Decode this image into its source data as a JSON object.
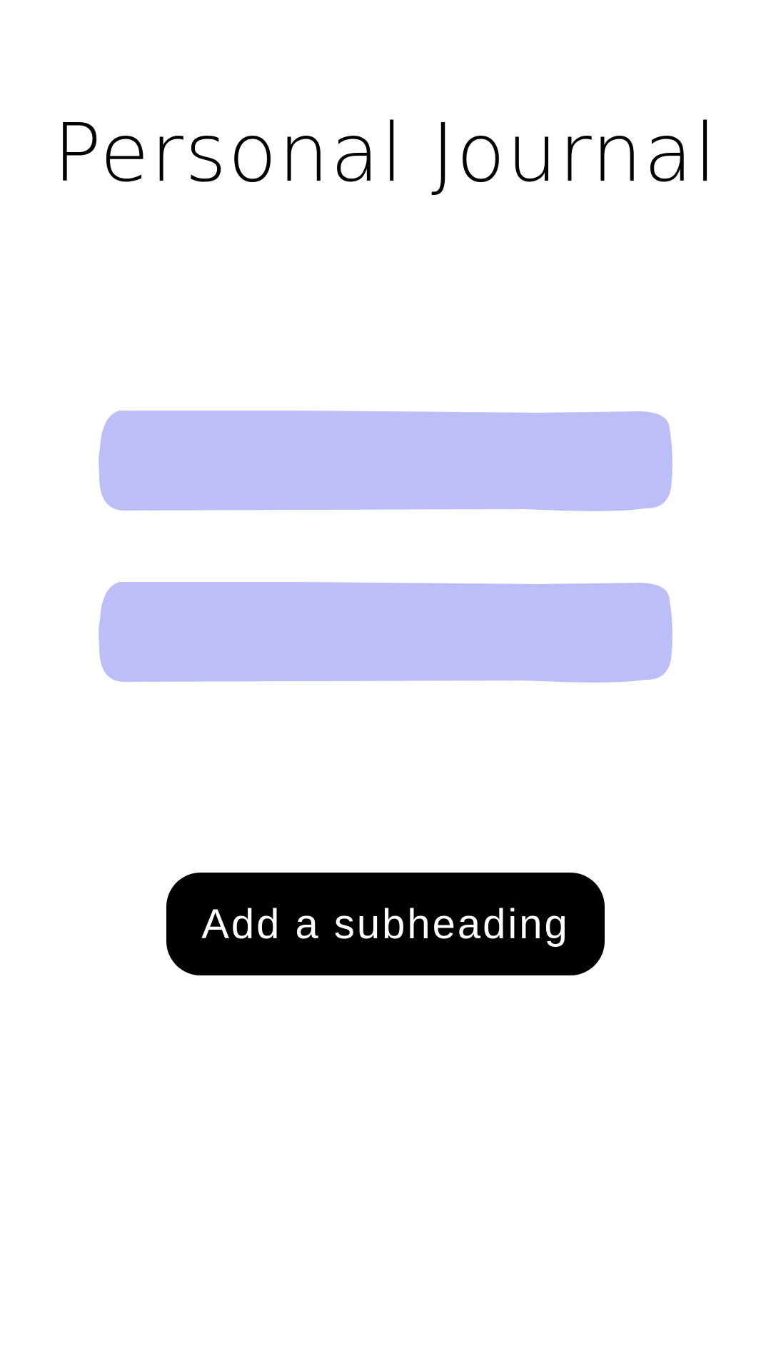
{
  "page": {
    "title": "Personal Journal"
  },
  "entry_blobs": {
    "count": 2,
    "color": "#BCBEF7"
  },
  "cta": {
    "label": "Add a subheading",
    "background": "#000000",
    "text_color": "#FFFFFF"
  }
}
